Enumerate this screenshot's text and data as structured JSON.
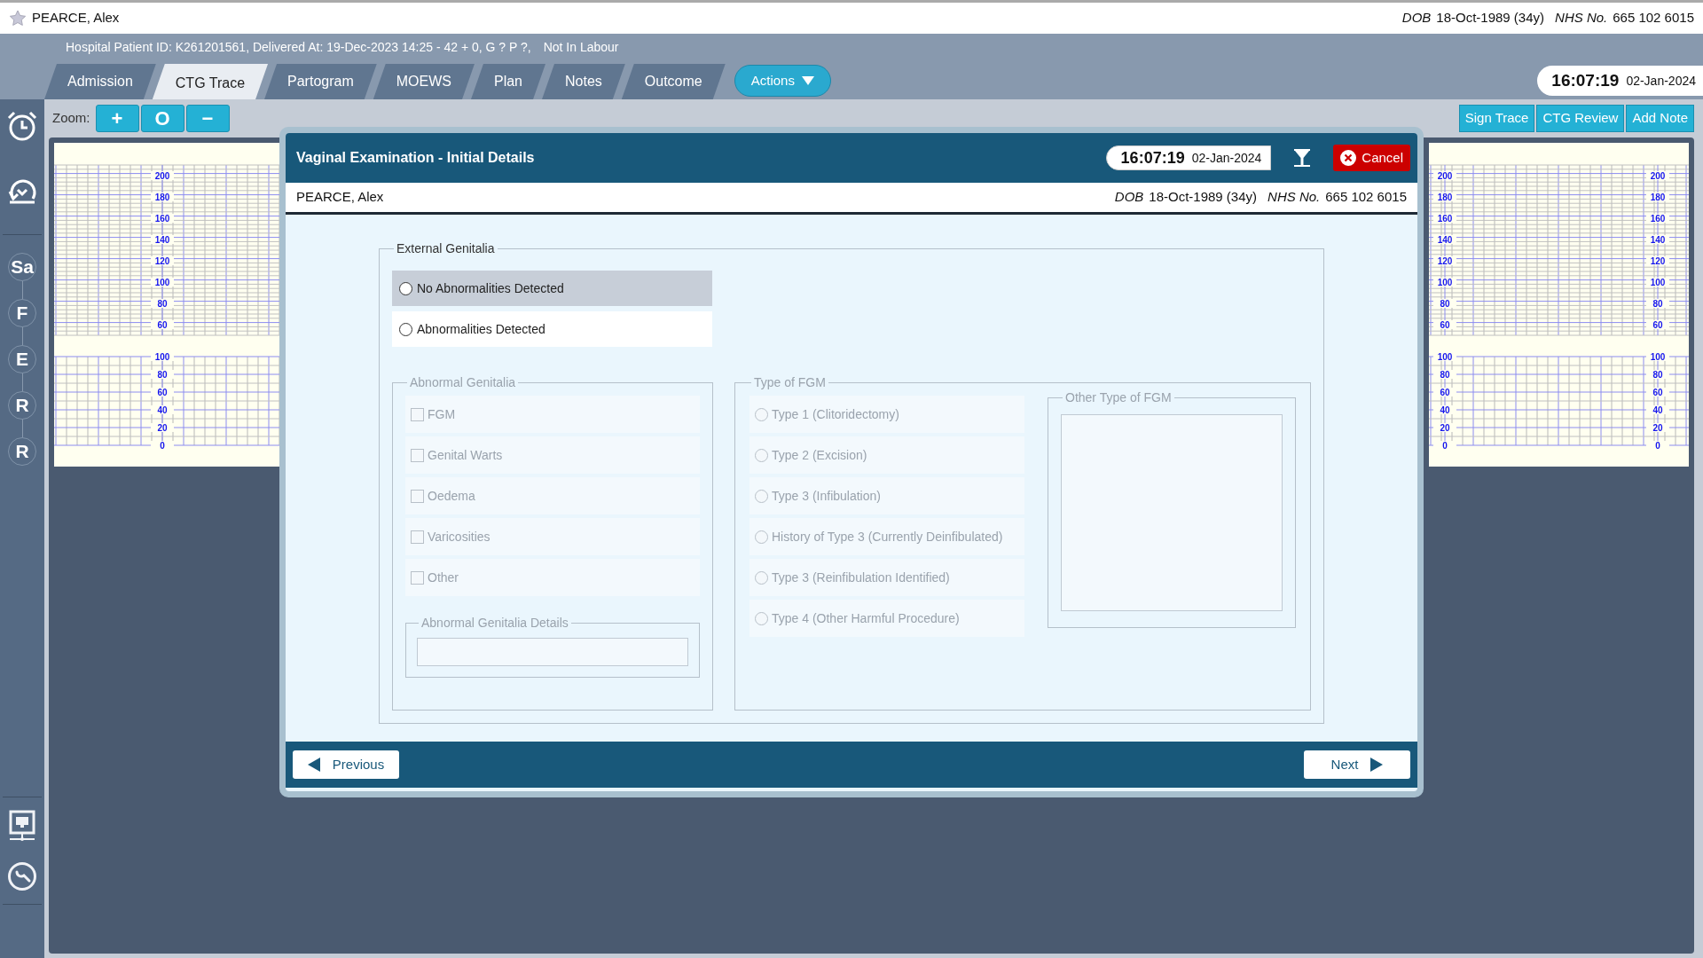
{
  "patient_bar": {
    "name": "PEARCE, Alex",
    "dob_label": "DOB",
    "dob": "18-Oct-1989 (34y)",
    "nhs_label": "NHS No.",
    "nhs": "665 102 6015"
  },
  "header": {
    "info": "Hospital Patient ID: K261201561, Delivered At: 19-Dec-2023 14:25 - 42 + 0, G ? P ?,",
    "status": "Not In Labour"
  },
  "tabs": [
    {
      "label": "Admission",
      "selected": false
    },
    {
      "label": "CTG Trace",
      "selected": true
    },
    {
      "label": "Partogram",
      "selected": false
    },
    {
      "label": "MOEWS",
      "selected": false
    },
    {
      "label": "Plan",
      "selected": false
    },
    {
      "label": "Notes",
      "selected": false
    },
    {
      "label": "Outcome",
      "selected": false
    }
  ],
  "actions_button": "Actions",
  "clock": {
    "time": "16:07:19",
    "date": "02-Jan-2024"
  },
  "zoom": {
    "label": "Zoom:",
    "buttons": [
      "+",
      "O",
      "−"
    ]
  },
  "trace_buttons": [
    "Sign Trace",
    "CTG Review",
    "Add Note"
  ],
  "sidebar": {
    "steps": [
      "Sa",
      "F",
      "E",
      "R",
      "R"
    ]
  },
  "ctg_panels": [
    {
      "axes": [
        {
          "fhr": [
            "200",
            "180",
            "160",
            "140",
            "120",
            "100",
            "80",
            "60"
          ],
          "toco": [
            "100",
            "80",
            "60",
            "40",
            "20",
            "0"
          ]
        }
      ]
    },
    {
      "axes": [
        {
          "fhr": [
            "200",
            "180",
            "160",
            "140",
            "120",
            "100",
            "80",
            "60"
          ],
          "toco": [
            "100",
            "80",
            "60",
            "40",
            "20",
            "0"
          ]
        },
        {
          "fhr": [
            "200",
            "180",
            "160",
            "140",
            "120",
            "100",
            "80",
            "60"
          ],
          "toco": [
            "100",
            "80",
            "60",
            "40",
            "20",
            "0"
          ]
        }
      ]
    }
  ],
  "dialog": {
    "title": "Vaginal Examination - Initial Details",
    "time": "16:07:19",
    "date": "02-Jan-2024",
    "cancel": "Cancel",
    "patient": {
      "name": "PEARCE, Alex",
      "dob_label": "DOB",
      "dob": "18-Oct-1989 (34y)",
      "nhs_label": "NHS No.",
      "nhs": "665 102 6015"
    },
    "external_genitalia": {
      "legend": "External Genitalia",
      "options": [
        {
          "label": "No Abnormalities Detected",
          "selected": false,
          "highlighted": true
        },
        {
          "label": "Abnormalities Detected",
          "selected": false,
          "highlighted": false
        }
      ]
    },
    "abnormal_genitalia": {
      "legend": "Abnormal Genitalia",
      "disabled": true,
      "items": [
        {
          "label": "FGM",
          "checked": false,
          "disabled": true
        },
        {
          "label": "Genital Warts",
          "checked": false,
          "disabled": true
        },
        {
          "label": "Oedema",
          "checked": false,
          "disabled": true
        },
        {
          "label": "Varicosities",
          "checked": false,
          "disabled": true
        },
        {
          "label": "Other",
          "checked": false,
          "disabled": true
        }
      ],
      "details": {
        "legend": "Abnormal Genitalia Details",
        "disabled": true
      }
    },
    "fgm_type": {
      "legend": "Type of FGM",
      "disabled": true,
      "options": [
        {
          "label": "Type 1 (Clitoridectomy)",
          "selected": false,
          "disabled": true
        },
        {
          "label": "Type 2 (Excision)",
          "selected": false,
          "disabled": true
        },
        {
          "label": "Type 3 (Infibulation)",
          "selected": false,
          "disabled": true
        },
        {
          "label": "History of Type 3 (Currently Deinfibulated)",
          "selected": false,
          "disabled": true
        },
        {
          "label": "Type 3 (Reinfibulation Identified)",
          "selected": false,
          "disabled": true
        },
        {
          "label": "Type 4 (Other Harmful Procedure)",
          "selected": false,
          "disabled": true
        }
      ],
      "other": {
        "legend": "Other Type of FGM",
        "disabled": true
      }
    },
    "previous": "Previous",
    "next": "Next"
  }
}
